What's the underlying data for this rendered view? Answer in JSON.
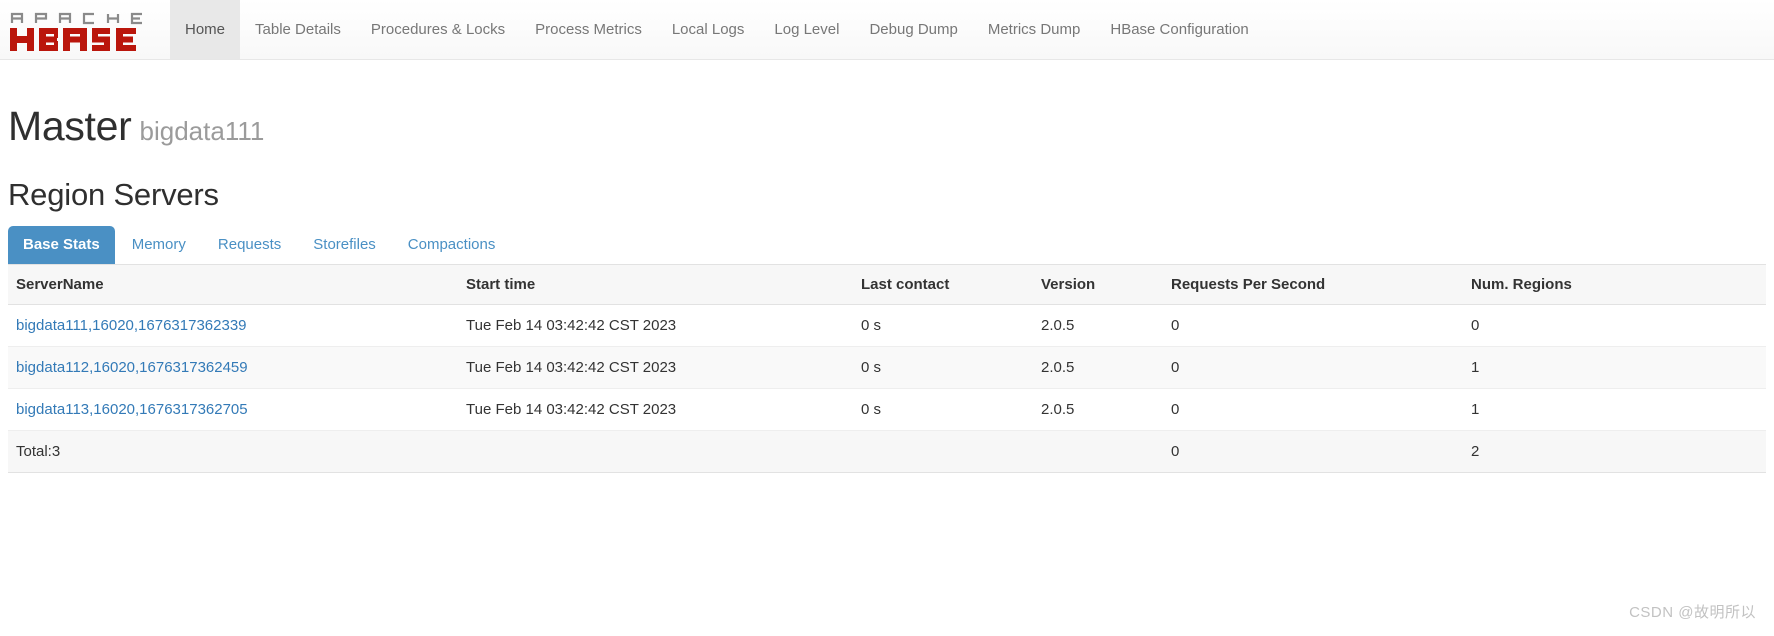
{
  "navbar": {
    "brand": {
      "apache_text": "APACHE",
      "hbase_text": "HBASE",
      "apache_color": "#8a8a8a",
      "hbase_color": "#ba160c"
    },
    "items": [
      {
        "label": "Home",
        "active": true
      },
      {
        "label": "Table Details",
        "active": false
      },
      {
        "label": "Procedures & Locks",
        "active": false
      },
      {
        "label": "Process Metrics",
        "active": false
      },
      {
        "label": "Local Logs",
        "active": false
      },
      {
        "label": "Log Level",
        "active": false
      },
      {
        "label": "Debug Dump",
        "active": false
      },
      {
        "label": "Metrics Dump",
        "active": false
      },
      {
        "label": "HBase Configuration",
        "active": false
      }
    ]
  },
  "page_header": {
    "title": "Master",
    "subtitle": "bigdata111"
  },
  "region_servers": {
    "section_title": "Region Servers",
    "tabs": [
      {
        "label": "Base Stats",
        "active": true
      },
      {
        "label": "Memory",
        "active": false
      },
      {
        "label": "Requests",
        "active": false
      },
      {
        "label": "Storefiles",
        "active": false
      },
      {
        "label": "Compactions",
        "active": false
      }
    ],
    "table": {
      "headers": [
        "ServerName",
        "Start time",
        "Last contact",
        "Version",
        "Requests Per Second",
        "Num. Regions"
      ],
      "rows": [
        {
          "server_name": "bigdata111,16020,1676317362339",
          "start_time": "Tue Feb 14 03:42:42 CST 2023",
          "last_contact": "0 s",
          "version": "2.0.5",
          "requests_per_second": "0",
          "num_regions": "0"
        },
        {
          "server_name": "bigdata112,16020,1676317362459",
          "start_time": "Tue Feb 14 03:42:42 CST 2023",
          "last_contact": "0 s",
          "version": "2.0.5",
          "requests_per_second": "0",
          "num_regions": "1"
        },
        {
          "server_name": "bigdata113,16020,1676317362705",
          "start_time": "Tue Feb 14 03:42:42 CST 2023",
          "last_contact": "0 s",
          "version": "2.0.5",
          "requests_per_second": "0",
          "num_regions": "1"
        }
      ],
      "total_row": {
        "label": "Total:3",
        "start_time": "",
        "last_contact": "",
        "version": "",
        "requests_per_second": "0",
        "num_regions": "2"
      }
    }
  },
  "watermark": {
    "text": "CSDN @故明所以"
  },
  "colors": {
    "accent_blue": "#4a90c4",
    "link_blue": "#337ab7",
    "hbase_red": "#ba160c",
    "nav_text": "#777777"
  }
}
